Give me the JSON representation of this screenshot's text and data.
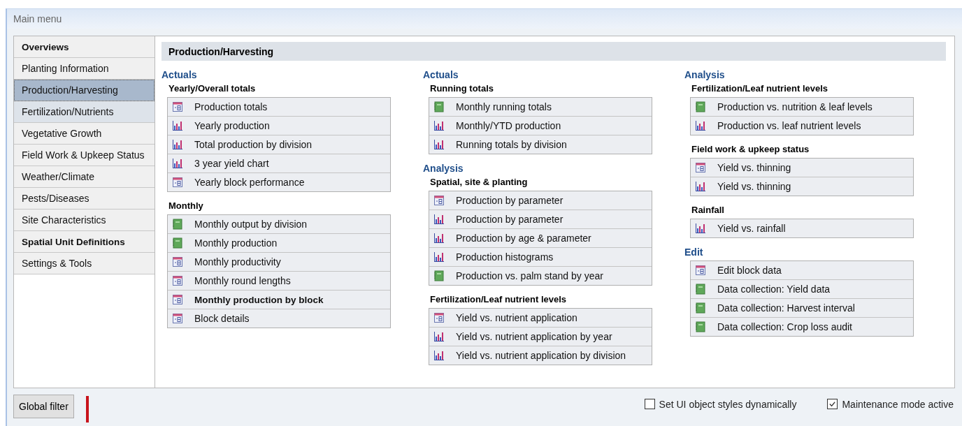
{
  "window": {
    "title": "Main menu"
  },
  "sidebar": {
    "items": [
      {
        "label": "Overviews",
        "selected": false,
        "bold": true,
        "hover": false
      },
      {
        "label": "Planting Information",
        "selected": false,
        "bold": false,
        "hover": false
      },
      {
        "label": "Production/Harvesting",
        "selected": true,
        "bold": false,
        "hover": false
      },
      {
        "label": "Fertilization/Nutrients",
        "selected": false,
        "bold": false,
        "hover": true
      },
      {
        "label": "Vegetative Growth",
        "selected": false,
        "bold": false,
        "hover": false
      },
      {
        "label": "Field Work & Upkeep Status",
        "selected": false,
        "bold": false,
        "hover": false
      },
      {
        "label": "Weather/Climate",
        "selected": false,
        "bold": false,
        "hover": false
      },
      {
        "label": "Pests/Diseases",
        "selected": false,
        "bold": false,
        "hover": false
      },
      {
        "label": "Site Characteristics",
        "selected": false,
        "bold": false,
        "hover": false
      },
      {
        "label": "Spatial Unit Definitions",
        "selected": false,
        "bold": true,
        "hover": false
      },
      {
        "label": "Settings & Tools",
        "selected": false,
        "bold": false,
        "hover": false
      }
    ]
  },
  "content": {
    "title": "Production/Harvesting",
    "columns": [
      {
        "sections": [
          {
            "heading": "Actuals",
            "groups": [
              {
                "title": "Yearly/Overall totals",
                "items": [
                  {
                    "kind": "form",
                    "label": "Production totals",
                    "bold": false
                  },
                  {
                    "kind": "chart",
                    "label": "Yearly production",
                    "bold": false
                  },
                  {
                    "kind": "chart",
                    "label": "Total production by division",
                    "bold": false
                  },
                  {
                    "kind": "chart",
                    "label": "3 year yield chart",
                    "bold": false
                  },
                  {
                    "kind": "form",
                    "label": "Yearly block performance",
                    "bold": false
                  }
                ]
              },
              {
                "title": "Monthly",
                "items": [
                  {
                    "kind": "report",
                    "label": "Monthly output by division",
                    "bold": false
                  },
                  {
                    "kind": "report",
                    "label": "Monthly production",
                    "bold": false
                  },
                  {
                    "kind": "form",
                    "label": "Monthly productivity",
                    "bold": false
                  },
                  {
                    "kind": "form",
                    "label": "Monthly round lengths",
                    "bold": false
                  },
                  {
                    "kind": "form",
                    "label": "Monthly production by block",
                    "bold": true
                  },
                  {
                    "kind": "form",
                    "label": "Block details",
                    "bold": false
                  }
                ]
              }
            ]
          }
        ]
      },
      {
        "sections": [
          {
            "heading": "Actuals",
            "groups": [
              {
                "title": "Running totals",
                "items": [
                  {
                    "kind": "report",
                    "label": "Monthly running totals",
                    "bold": false
                  },
                  {
                    "kind": "chart",
                    "label": "Monthly/YTD production",
                    "bold": false
                  },
                  {
                    "kind": "chart",
                    "label": "Running totals by division",
                    "bold": false
                  }
                ]
              }
            ]
          },
          {
            "heading": "Analysis",
            "groups": [
              {
                "title": "Spatial, site & planting",
                "items": [
                  {
                    "kind": "form",
                    "label": "Production by parameter",
                    "bold": false
                  },
                  {
                    "kind": "chart",
                    "label": "Production by parameter",
                    "bold": false
                  },
                  {
                    "kind": "chart",
                    "label": "Production by age & parameter",
                    "bold": false
                  },
                  {
                    "kind": "chart",
                    "label": "Production histograms",
                    "bold": false
                  },
                  {
                    "kind": "report",
                    "label": "Production vs. palm stand by year",
                    "bold": false
                  }
                ]
              },
              {
                "title": "Fertilization/Leaf nutrient levels",
                "items": [
                  {
                    "kind": "form",
                    "label": "Yield vs. nutrient application",
                    "bold": false
                  },
                  {
                    "kind": "chart",
                    "label": "Yield vs. nutrient application by year",
                    "bold": false
                  },
                  {
                    "kind": "chart",
                    "label": "Yield vs. nutrient application by division",
                    "bold": false
                  }
                ]
              }
            ]
          }
        ]
      },
      {
        "sections": [
          {
            "heading": "Analysis",
            "groups": [
              {
                "title": "Fertilization/Leaf nutrient levels",
                "items": [
                  {
                    "kind": "report",
                    "label": "Production vs. nutrition & leaf levels",
                    "bold": false
                  },
                  {
                    "kind": "chart",
                    "label": "Production vs. leaf nutrient levels",
                    "bold": false
                  }
                ]
              },
              {
                "title": "Field work & upkeep status",
                "items": [
                  {
                    "kind": "form",
                    "label": "Yield vs. thinning",
                    "bold": false
                  },
                  {
                    "kind": "chart",
                    "label": "Yield vs. thinning",
                    "bold": false
                  }
                ]
              },
              {
                "title": "Rainfall",
                "items": [
                  {
                    "kind": "chart",
                    "label": "Yield vs. rainfall",
                    "bold": false
                  }
                ]
              }
            ]
          },
          {
            "heading": "Edit",
            "groups": [
              {
                "items": [
                  {
                    "kind": "form",
                    "label": "Edit block data",
                    "bold": false
                  },
                  {
                    "kind": "report",
                    "label": "Data collection: Yield data",
                    "bold": false
                  },
                  {
                    "kind": "report",
                    "label": "Data collection: Harvest interval",
                    "bold": false
                  },
                  {
                    "kind": "report",
                    "label": "Data collection: Crop loss audit",
                    "bold": false
                  }
                ]
              }
            ]
          }
        ]
      }
    ]
  },
  "footer": {
    "button": "Global filter",
    "checkboxes": [
      {
        "label": "Set UI object styles dynamically",
        "checked": false
      },
      {
        "label": "Maintenance mode active",
        "checked": true
      }
    ]
  }
}
